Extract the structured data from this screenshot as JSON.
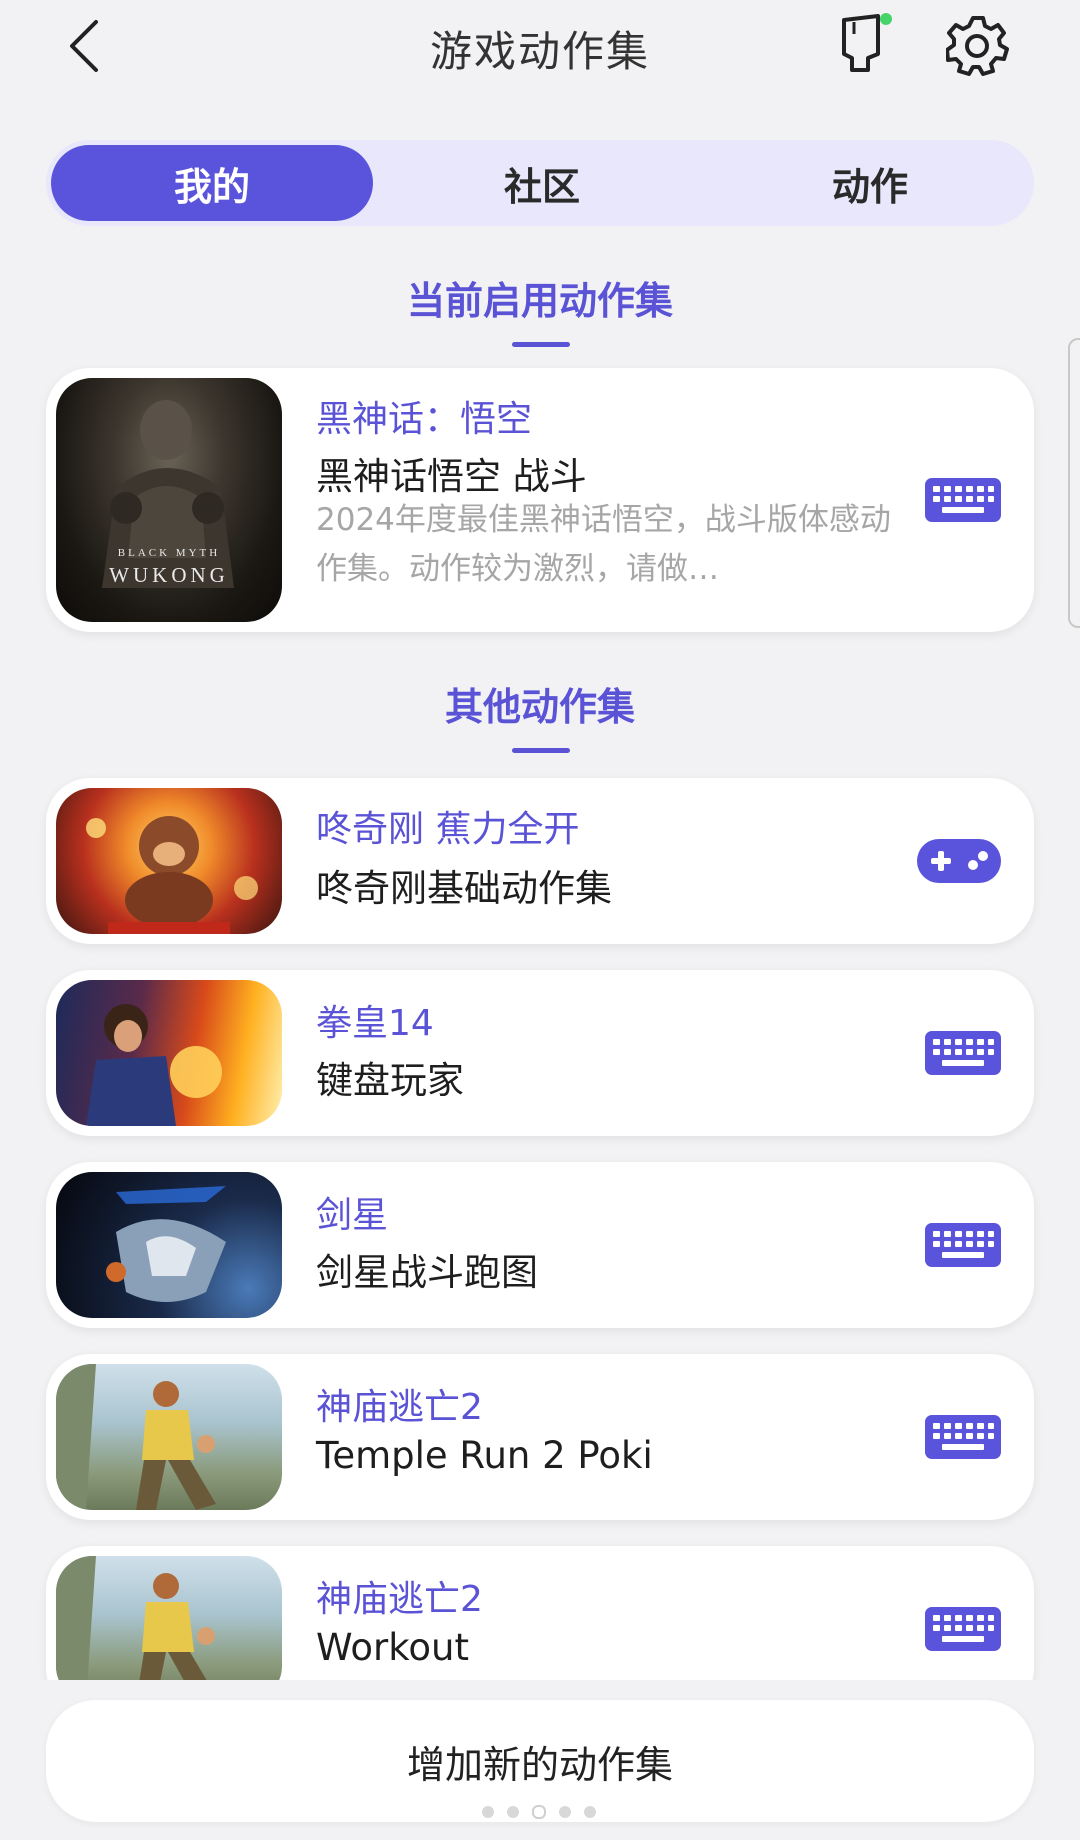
{
  "header": {
    "title": "游戏动作集",
    "icons": [
      "back-arrow-icon",
      "device-connected-icon",
      "settings-gear-icon"
    ]
  },
  "tabs": [
    {
      "label": "我的",
      "active": true
    },
    {
      "label": "社区",
      "active": false
    },
    {
      "label": "动作",
      "active": false
    }
  ],
  "current_section": {
    "title": "当前启用动作集",
    "item": {
      "name": "黑神话：悟空",
      "subtitle": "黑神话悟空 战斗",
      "description": "2024年度最佳黑神话悟空，战斗版体感动作集。动作较为激烈，请做…",
      "thumb_small": "BLACK MYTH",
      "thumb_big": "WUKONG",
      "control_icon": "keyboard-icon"
    }
  },
  "other_section": {
    "title": "其他动作集",
    "items": [
      {
        "name": "咚奇刚 蕉力全开",
        "subtitle": "咚奇刚基础动作集",
        "control_icon": "gamepad-icon"
      },
      {
        "name": "拳皇14",
        "subtitle": "键盘玩家",
        "control_icon": "keyboard-icon"
      },
      {
        "name": "剑星",
        "subtitle": "剑星战斗跑图",
        "control_icon": "keyboard-icon"
      },
      {
        "name": "神庙逃亡2",
        "subtitle": "Temple Run 2 Poki",
        "control_icon": "keyboard-icon"
      },
      {
        "name": "神庙逃亡2",
        "subtitle": "Workout",
        "control_icon": "keyboard-icon"
      }
    ]
  },
  "footer": {
    "add_button": "增加新的动作集",
    "page_count": 5,
    "active_page": 3
  },
  "colors": {
    "accent": "#5a54dc",
    "accent_text": "#5b53d6",
    "tab_track": "#e8e7fb",
    "background": "#f2f2f4"
  }
}
